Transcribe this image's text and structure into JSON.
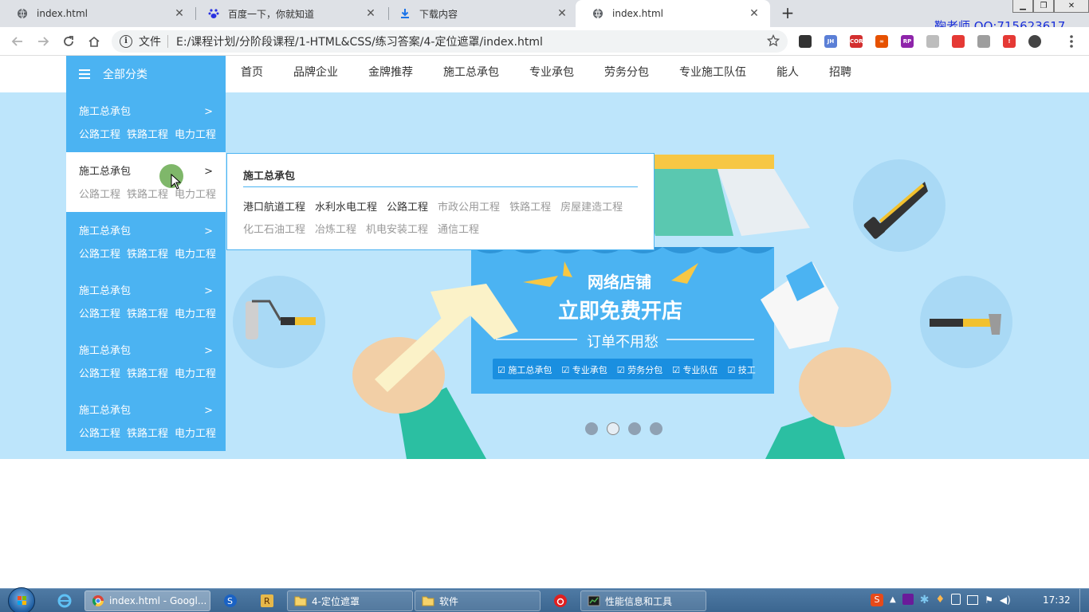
{
  "browser": {
    "tabs": [
      {
        "title": "index.html",
        "icon": "globe-icon",
        "active": false
      },
      {
        "title": "百度一下，你就知道",
        "icon": "baidu-paw-icon",
        "active": false
      },
      {
        "title": "下载内容",
        "icon": "download-icon",
        "active": false
      },
      {
        "title": "index.html",
        "icon": "globe-icon",
        "active": true
      }
    ],
    "new_tab_label": "+",
    "teacher_label": "鞠老师 QQ:715623617",
    "address": {
      "scheme_label": "文件",
      "url": "E:/课程计划/分阶段课程/1-HTML&CSS/练习答案/4-定位遮罩/index.html"
    },
    "extensions": [
      {
        "name": "undo-ext-icon",
        "label": "",
        "color": "#333333"
      },
      {
        "name": "jh-ext-icon",
        "label": "JH",
        "color": "#5b7fd6"
      },
      {
        "name": "cors-ext-icon",
        "label": "CORS",
        "color": "#d32f2f"
      },
      {
        "name": "infinity-ext-icon",
        "label": "∞",
        "color": "#e65100"
      },
      {
        "name": "rp-ext-icon",
        "label": "RP",
        "color": "#8e24aa"
      },
      {
        "name": "puzzle-ext-icon",
        "label": "",
        "color": "#bdbdbd"
      },
      {
        "name": "stop-ext-icon",
        "label": "",
        "color": "#e53935"
      },
      {
        "name": "vue-ext-icon",
        "label": "",
        "color": "#9e9e9e"
      },
      {
        "name": "blocked-ext-icon",
        "label": "!",
        "color": "#e53935"
      },
      {
        "name": "profile-avatar-icon",
        "label": "",
        "color": "#444444"
      }
    ]
  },
  "site": {
    "menu_label": "全部分类",
    "nav": [
      "首页",
      "品牌企业",
      "金牌推荐",
      "施工总承包",
      "专业承包",
      "劳务分包",
      "专业施工队伍",
      "能人",
      "招聘"
    ],
    "categories": [
      {
        "title": "施工总承包",
        "arrow": ">",
        "links": [
          "公路工程",
          "铁路工程",
          "电力工程"
        ]
      },
      {
        "title": "施工总承包",
        "arrow": ">",
        "links": [
          "公路工程",
          "铁路工程",
          "电力工程"
        ]
      },
      {
        "title": "施工总承包",
        "arrow": ">",
        "links": [
          "公路工程",
          "铁路工程",
          "电力工程"
        ]
      },
      {
        "title": "施工总承包",
        "arrow": ">",
        "links": [
          "公路工程",
          "铁路工程",
          "电力工程"
        ]
      },
      {
        "title": "施工总承包",
        "arrow": ">",
        "links": [
          "公路工程",
          "铁路工程",
          "电力工程"
        ]
      },
      {
        "title": "施工总承包",
        "arrow": ">",
        "links": [
          "公路工程",
          "铁路工程",
          "电力工程"
        ]
      }
    ],
    "active_category_index": 1,
    "flyout": {
      "title": "施工总承包",
      "links": [
        {
          "text": "港口航道工程",
          "dim": false
        },
        {
          "text": "水利水电工程",
          "dim": false
        },
        {
          "text": "公路工程",
          "dim": false
        },
        {
          "text": "市政公用工程",
          "dim": true
        },
        {
          "text": "铁路工程",
          "dim": true
        },
        {
          "text": "房屋建造工程",
          "dim": true
        },
        {
          "text": "化工石油工程",
          "dim": true
        },
        {
          "text": "冶炼工程",
          "dim": true
        },
        {
          "text": "机电安装工程",
          "dim": true
        },
        {
          "text": "通信工程",
          "dim": true
        }
      ]
    },
    "banner": {
      "headline": "网络店铺",
      "main_title": "立即免费开店",
      "subtitle": "订单不用愁",
      "checks": [
        "施工总承包",
        "专业承包",
        "劳务分包",
        "专业队伍",
        "技工"
      ],
      "carousel_dots": 4,
      "active_dot": 1,
      "colors": {
        "bg": "#bde5fb",
        "board": "#4bb3f2",
        "awning_teal": "#5ac8b0",
        "awning_yellow": "#f7c744",
        "sleeve": "#2bbfa2"
      }
    }
  },
  "taskbar": {
    "items": [
      {
        "name": "taskbar-ie-button",
        "label": "",
        "active": false
      },
      {
        "name": "taskbar-chrome-button",
        "label": "index.html - Googl...",
        "active": true
      },
      {
        "name": "taskbar-sogou-button",
        "label": "",
        "active": false
      },
      {
        "name": "taskbar-app-button",
        "label": "",
        "active": false
      },
      {
        "name": "taskbar-folder-positioning-button",
        "label": "4-定位遮罩",
        "active": false
      },
      {
        "name": "taskbar-folder-software-button",
        "label": "软件",
        "active": false
      },
      {
        "name": "taskbar-netease-button",
        "label": "",
        "active": false
      },
      {
        "name": "taskbar-perf-button",
        "label": "性能信息和工具",
        "active": false
      }
    ],
    "clock": "17:32"
  }
}
